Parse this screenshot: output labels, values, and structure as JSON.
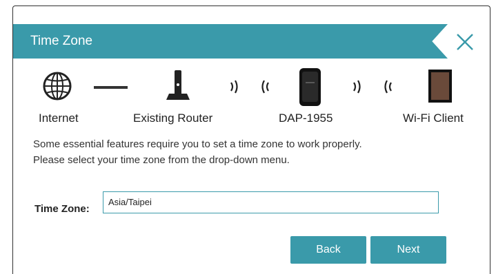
{
  "header": {
    "title": "Time Zone"
  },
  "icons": {
    "close": "close-icon",
    "internet": "globe-icon",
    "router": "router-icon",
    "extender": "extender-icon",
    "client": "tablet-icon",
    "wifi": "wifi-wave-icon"
  },
  "diagram": {
    "labels": [
      "Internet",
      "Existing Router",
      "DAP-1955",
      "Wi-Fi Client"
    ]
  },
  "description": {
    "line1": "Some essential features require you to set a time zone to work properly.",
    "line2": "Please select your time zone from the drop-down menu."
  },
  "form": {
    "time_zone_label": "Time Zone:",
    "time_zone_value": "Asia/Taipei"
  },
  "buttons": {
    "back": "Back",
    "next": "Next"
  },
  "colors": {
    "accent": "#3a9aaa",
    "text": "#333333"
  }
}
